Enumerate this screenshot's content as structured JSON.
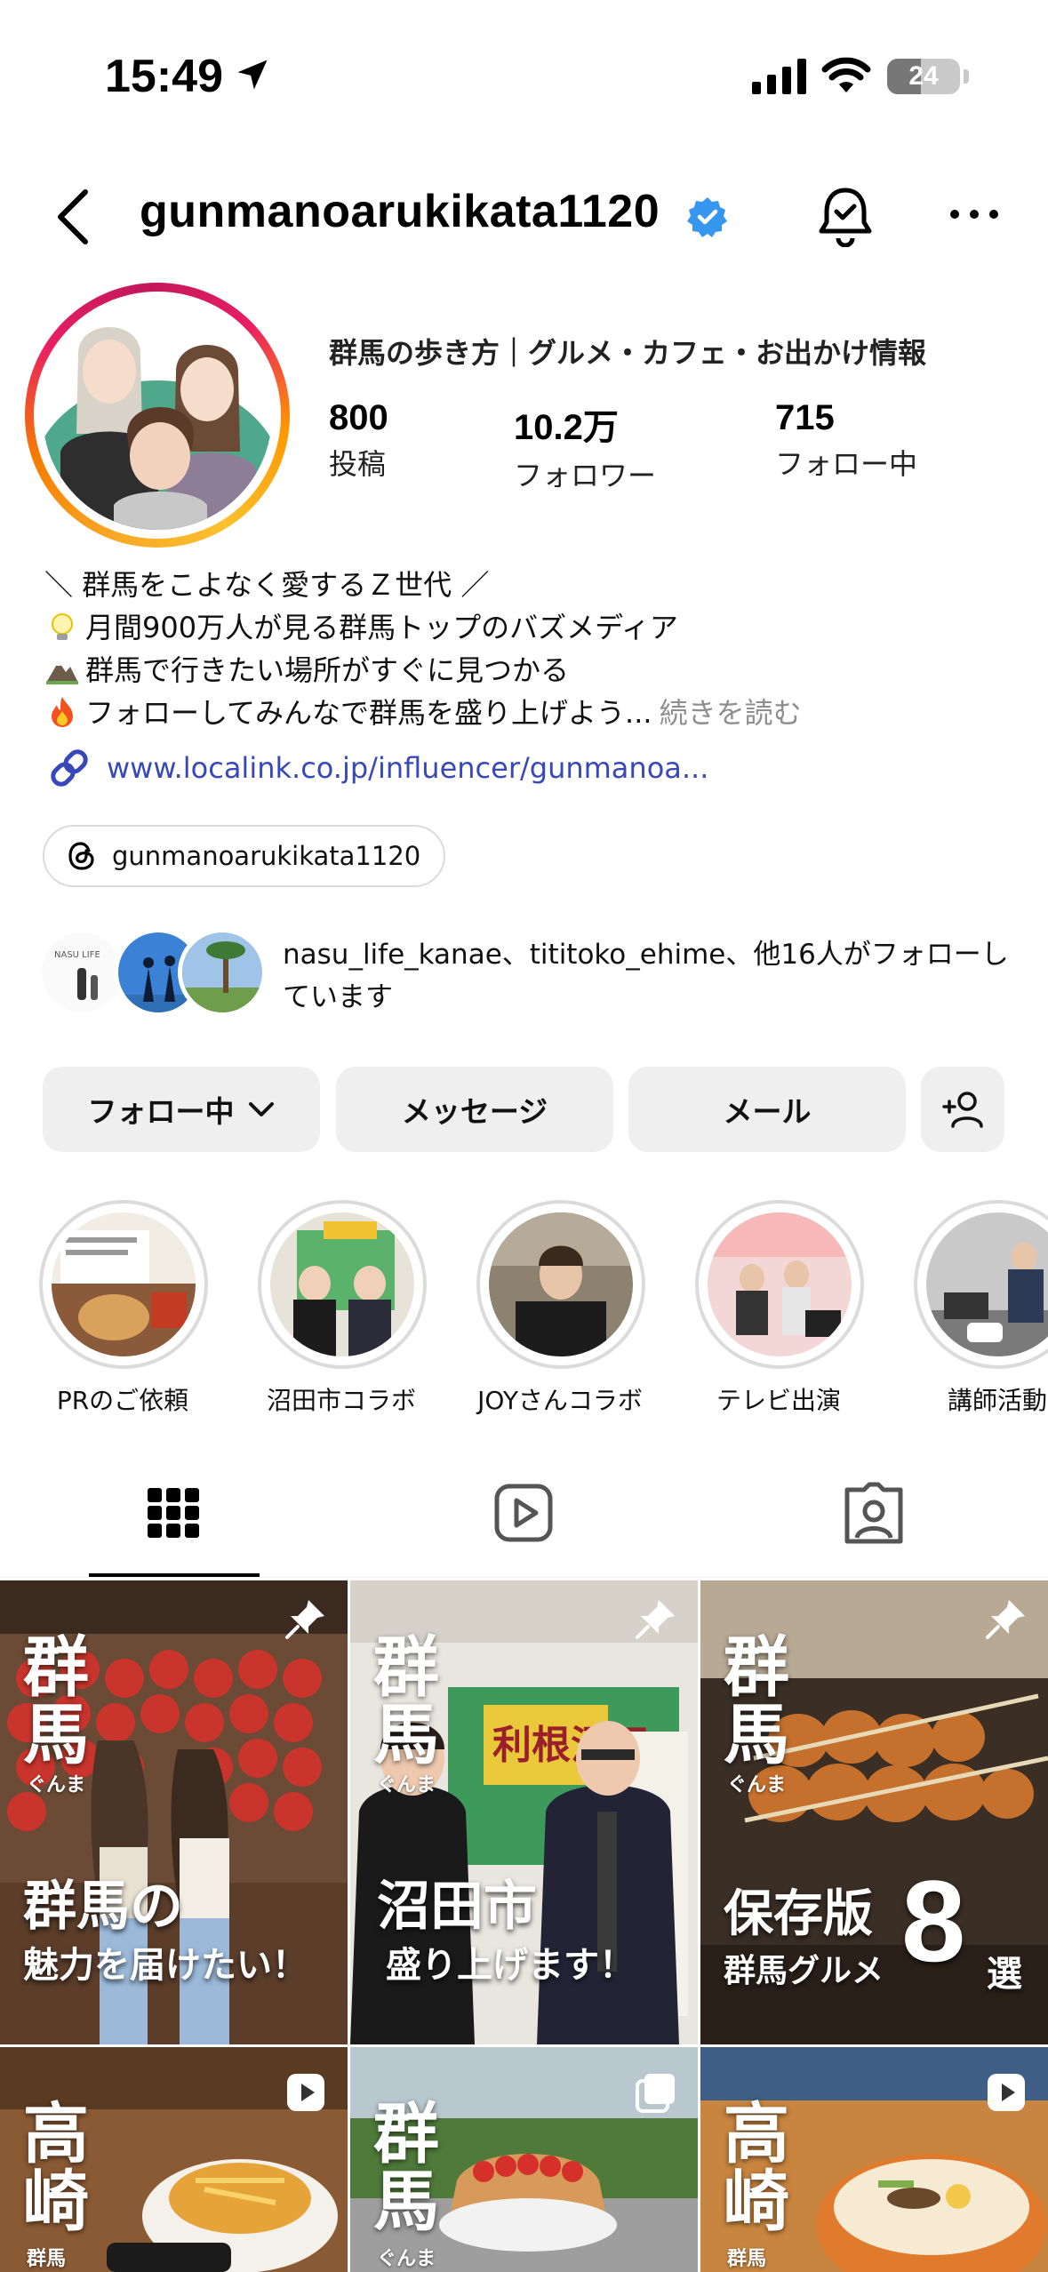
{
  "status_bar": {
    "time": "15:49",
    "battery": "24",
    "icons": [
      "location-arrow-icon",
      "cellular-signal-icon",
      "wifi-icon",
      "battery-icon"
    ]
  },
  "header": {
    "username": "gunmanoarukikata1120",
    "verified": true,
    "icons": [
      "back-icon",
      "verified-badge-icon",
      "notification-bell-icon",
      "more-icon"
    ]
  },
  "profile": {
    "category": "群馬の歩き方｜グルメ・カフェ・お出かけ情報",
    "stats": [
      {
        "value": "800",
        "label": "投稿"
      },
      {
        "value": "10.2万",
        "label": "フォロワー"
      },
      {
        "value": "715",
        "label": "フォロー中"
      }
    ],
    "bio": {
      "line1": "＼ 群馬をこよなく愛するＺ世代 ／",
      "line2": "月間900万人が見る群馬トップのバズメディア",
      "line3": "群馬で行きたい場所がすぐに見つかる",
      "line4": "フォローしてみんなで群馬を盛り上げよう...",
      "more": "続きを読む",
      "icons": [
        "lightbulb-icon",
        "mountain-icon",
        "fire-icon"
      ]
    },
    "link": "www.localink.co.jp/influencer/gunmanoa...",
    "threads": "gunmanoarukikata1120",
    "followed_by": "nasu_life_kanae、tititoko_ehime、他16人がフォローしています"
  },
  "buttons": {
    "following": "フォロー中",
    "message": "メッセージ",
    "email": "メール"
  },
  "highlights": [
    {
      "label": "PRのご依頼"
    },
    {
      "label": "沼田市コラボ"
    },
    {
      "label": "JOYさんコラボ"
    },
    {
      "label": "テレビ出演"
    },
    {
      "label": "講師活動"
    }
  ],
  "tabs": [
    "grid-icon",
    "reels-icon",
    "tagged-icon"
  ],
  "posts": [
    {
      "kanji": "群馬",
      "kana": "ぐんま",
      "cap1": "群馬の",
      "cap2": "魅力を届けたい！",
      "badge": "pin-icon"
    },
    {
      "kanji": "群馬",
      "kana": "ぐんま",
      "cap1": "沼田市",
      "cap2": "盛り上げます！",
      "badge": "pin-icon"
    },
    {
      "kanji": "群馬",
      "kana": "ぐんま",
      "cap1": "保存版",
      "cap2": "群馬グルメ",
      "big_num": "8",
      "suffix": "選",
      "badge": "pin-icon"
    },
    {
      "kanji": "高崎",
      "kana": "群馬",
      "badge": "reel-icon"
    },
    {
      "kanji": "群馬",
      "kana": "ぐんま",
      "badge": "carousel-icon"
    },
    {
      "kanji": "高崎",
      "kana": "群馬",
      "badge": "reel-icon"
    }
  ]
}
